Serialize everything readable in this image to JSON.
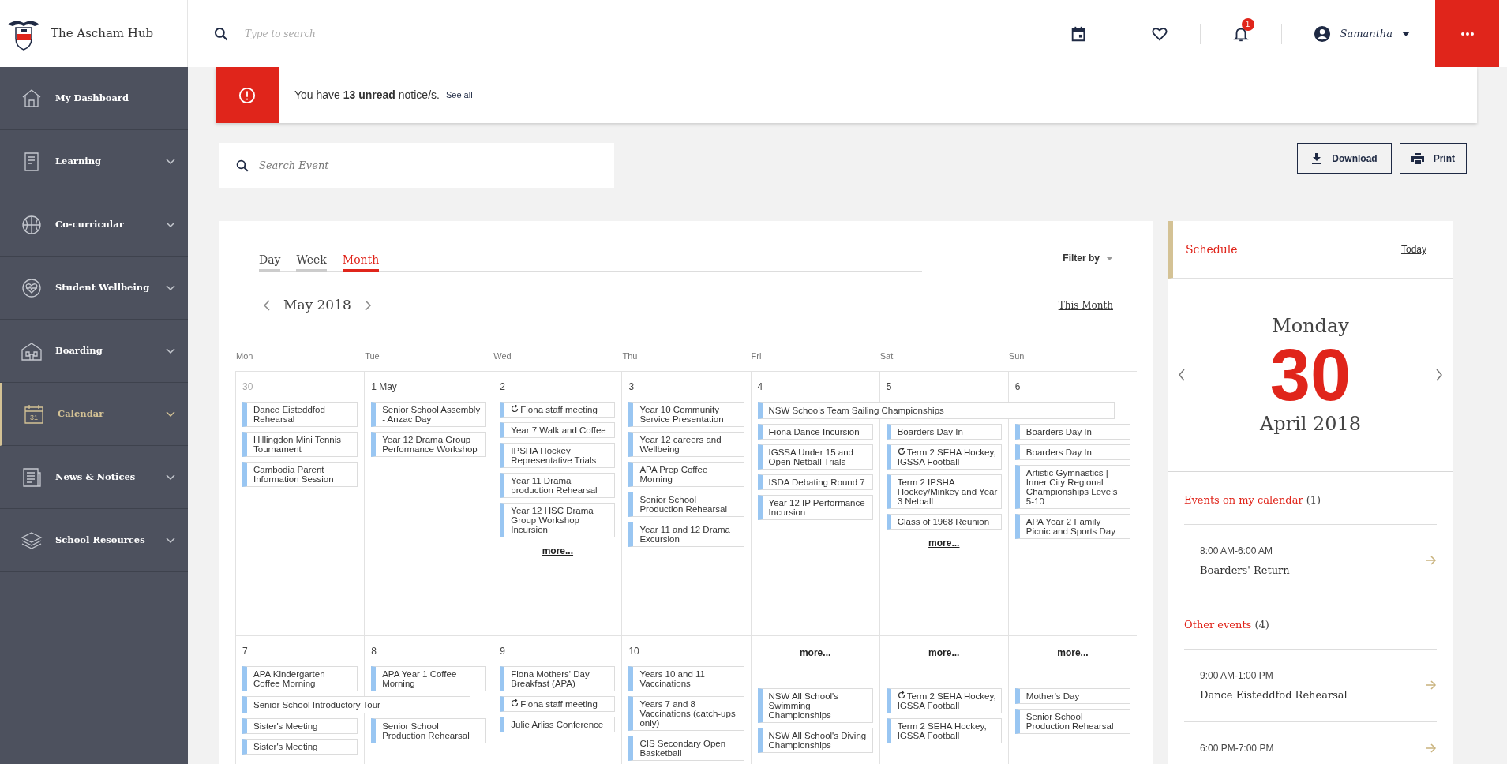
{
  "brand": {
    "title": "The Ascham Hub"
  },
  "header": {
    "search": {
      "placeholder": "Type to search"
    },
    "notifications": {
      "badge": "1"
    },
    "user": {
      "name": "Samantha"
    }
  },
  "sidebar": {
    "items": [
      {
        "label": "My Dashboard",
        "selected": false,
        "expandable": false
      },
      {
        "label": "Learning",
        "selected": false,
        "expandable": true
      },
      {
        "label": "Co-curricular",
        "selected": false,
        "expandable": true
      },
      {
        "label": "Student Wellbeing",
        "selected": false,
        "expandable": true
      },
      {
        "label": "Boarding",
        "selected": false,
        "expandable": true
      },
      {
        "label": "Calendar",
        "selected": true,
        "expandable": true,
        "icon_label": "31"
      },
      {
        "label": "News & Notices",
        "selected": false,
        "expandable": true
      },
      {
        "label": "School Resources",
        "selected": false,
        "expandable": true
      }
    ]
  },
  "notice": {
    "message": "You have **13 unread** notice/s.",
    "link": "See all"
  },
  "event_search": {
    "placeholder": "Search Event"
  },
  "actions": [
    {
      "label": "Download",
      "kind": "download"
    },
    {
      "label": "Print",
      "kind": "print"
    }
  ],
  "calendar": {
    "views": [
      {
        "label": "Day",
        "selected": false
      },
      {
        "label": "Week",
        "selected": false
      },
      {
        "label": "Month",
        "selected": true
      }
    ],
    "filter": "Filter by",
    "month": "May 2018",
    "this_month": "This Month",
    "weekdays": [
      "Mon",
      "Tue",
      "Wed",
      "Thu",
      "Fri",
      "Sat",
      "Sun"
    ],
    "weeks": [
      {
        "days": [
          {
            "date": "30",
            "other_month": true,
            "items": [
              {
                "kind": "event",
                "title": "Dance Eisteddfod Rehearsal",
                "recurring": false
              },
              {
                "kind": "event",
                "title": "Hillingdon Mini Tennis Tournament",
                "recurring": false
              },
              {
                "kind": "event",
                "title": "Cambodia Parent Information Session",
                "recurring": false
              }
            ]
          },
          {
            "date": "1 May",
            "other_month": false,
            "items": [
              {
                "kind": "event",
                "title": "Senior School Assembly - Anzac Day",
                "recurring": false
              },
              {
                "kind": "event",
                "title": "Year 12 Drama Group Performance Workshop",
                "recurring": false
              }
            ]
          },
          {
            "date": "2",
            "other_month": false,
            "items": [
              {
                "kind": "event",
                "title": "Fiona staff meeting",
                "recurring": true
              },
              {
                "kind": "event",
                "title": "Year 7 Walk and Coffee",
                "recurring": false
              },
              {
                "kind": "event",
                "title": "IPSHA Hockey Representative Trials",
                "recurring": false
              },
              {
                "kind": "event",
                "title": "Year 11 Drama production Rehearsal",
                "recurring": false
              },
              {
                "kind": "event",
                "title": "Year 12 HSC Drama Group Workshop Incursion",
                "recurring": false
              },
              {
                "kind": "more",
                "title": "more..."
              }
            ]
          },
          {
            "date": "3",
            "other_month": false,
            "items": [
              {
                "kind": "event",
                "title": "Year 10 Community Service Presentation",
                "recurring": false
              },
              {
                "kind": "event",
                "title": "Year 12 careers and Wellbeing",
                "recurring": false
              },
              {
                "kind": "event",
                "title": "APA Prep Coffee Morning",
                "recurring": false
              },
              {
                "kind": "event",
                "title": "Senior School Production Rehearsal",
                "recurring": false
              },
              {
                "kind": "event",
                "title": "Year 11 and 12 Drama Excursion",
                "recurring": false
              }
            ]
          },
          {
            "date": "4",
            "other_month": false,
            "items": [
              {
                "kind": "multi_day",
                "title": "NSW Schools Team Sailing Championships"
              },
              {
                "kind": "event",
                "title": "Fiona Dance Incursion",
                "recurring": false
              },
              {
                "kind": "event",
                "title": "IGSSA Under 15 and Open Netball Trials",
                "recurring": false
              },
              {
                "kind": "event",
                "title": "ISDA Debating Round 7",
                "recurring": false
              },
              {
                "kind": "event",
                "title": "Year 12 IP Performance Incursion",
                "recurring": false
              }
            ]
          },
          {
            "date": "5",
            "other_month": false,
            "items": [
              {
                "kind": "continued"
              },
              {
                "kind": "event",
                "title": "Boarders Day In",
                "recurring": false
              },
              {
                "kind": "event",
                "title": "Term 2 SEHA Hockey, IGSSA Football",
                "recurring": true
              },
              {
                "kind": "event",
                "title": "Term 2 IPSHA Hockey/Minkey and Year 3 Netball",
                "recurring": false
              },
              {
                "kind": "event",
                "title": "Class of 1968 Reunion",
                "recurring": false
              },
              {
                "kind": "more",
                "title": "more..."
              }
            ]
          },
          {
            "date": "6",
            "other_month": false,
            "items": [
              {
                "kind": "continued"
              },
              {
                "kind": "event",
                "title": "Boarders Day In",
                "recurring": false
              },
              {
                "kind": "event",
                "title": "Boarders Day In",
                "recurring": false
              },
              {
                "kind": "event",
                "title": "Artistic Gymnastics | Inner City Regional Championships Levels 5-10",
                "recurring": false
              },
              {
                "kind": "event",
                "title": "APA Year 2 Family Picnic and Sports Day",
                "recurring": false
              }
            ]
          }
        ]
      },
      {
        "days": [
          {
            "date": "7",
            "other_month": false,
            "items": [
              {
                "kind": "event",
                "title": "APA Kindergarten Coffee Morning",
                "recurring": false
              },
              {
                "kind": "multi_day",
                "title": "Senior School Introductory Tour"
              },
              {
                "kind": "event",
                "title": "Sister's Meeting",
                "recurring": false
              },
              {
                "kind": "event",
                "title": "Sister's Meeting",
                "recurring": false
              }
            ]
          },
          {
            "date": "8",
            "other_month": false,
            "items": [
              {
                "kind": "event",
                "title": "APA Year 1 Coffee Morning",
                "recurring": false
              },
              {
                "kind": "continued"
              },
              {
                "kind": "event",
                "title": "Senior School Production Rehearsal",
                "recurring": false
              }
            ]
          },
          {
            "date": "9",
            "other_month": false,
            "items": [
              {
                "kind": "event",
                "title": "Fiona Mothers' Day Breakfast (APA)",
                "recurring": false
              },
              {
                "kind": "event",
                "title": "Fiona staff meeting",
                "recurring": true
              },
              {
                "kind": "event",
                "title": "Julie Arliss Conference",
                "recurring": false
              }
            ]
          },
          {
            "date": "10",
            "other_month": false,
            "items": [
              {
                "kind": "event",
                "title": "Years 10 and 11 Vaccinations",
                "recurring": false
              },
              {
                "kind": "event",
                "title": "Years 7 and 8 Vaccinations (catch-ups only)",
                "recurring": false
              },
              {
                "kind": "event",
                "title": "CIS Secondary Open Basketball",
                "recurring": false
              }
            ]
          },
          {
            "items": [
              {
                "kind": "more",
                "title": "more..."
              },
              {
                "kind": "event",
                "title": "NSW All School's Swimming Championships",
                "recurring": false
              },
              {
                "kind": "event",
                "title": "NSW All School's Diving Championships",
                "recurring": false
              }
            ]
          },
          {
            "items": [
              {
                "kind": "more",
                "title": "more..."
              },
              {
                "kind": "event",
                "title": "Term 2 SEHA Hockey, IGSSA Football",
                "recurring": true
              },
              {
                "kind": "event",
                "title": "Term 2 SEHA Hockey, IGSSA Football",
                "recurring": false
              }
            ]
          },
          {
            "items": [
              {
                "kind": "more",
                "title": "more..."
              },
              {
                "kind": "event",
                "title": "Mother's Day",
                "recurring": false
              },
              {
                "kind": "event",
                "title": "Senior School Production Rehearsal",
                "recurring": false
              }
            ]
          }
        ]
      }
    ]
  },
  "schedule": {
    "title": "Schedule",
    "today": "Today",
    "weekday": "Monday",
    "day": "30",
    "month_year": "April 2018",
    "sections": [
      {
        "title": "Events on my calendar",
        "count": "(1)",
        "events": [
          {
            "time": "8:00 AM-6:00 AM",
            "title": "Boarders' Return"
          }
        ]
      },
      {
        "title": "Other events",
        "count": "(4)",
        "events": [
          {
            "time": "9:00 AM-1:00 PM",
            "title": "Dance Eisteddfod Rehearsal"
          },
          {
            "time": "6:00 PM-7:00 PM"
          }
        ]
      }
    ]
  }
}
